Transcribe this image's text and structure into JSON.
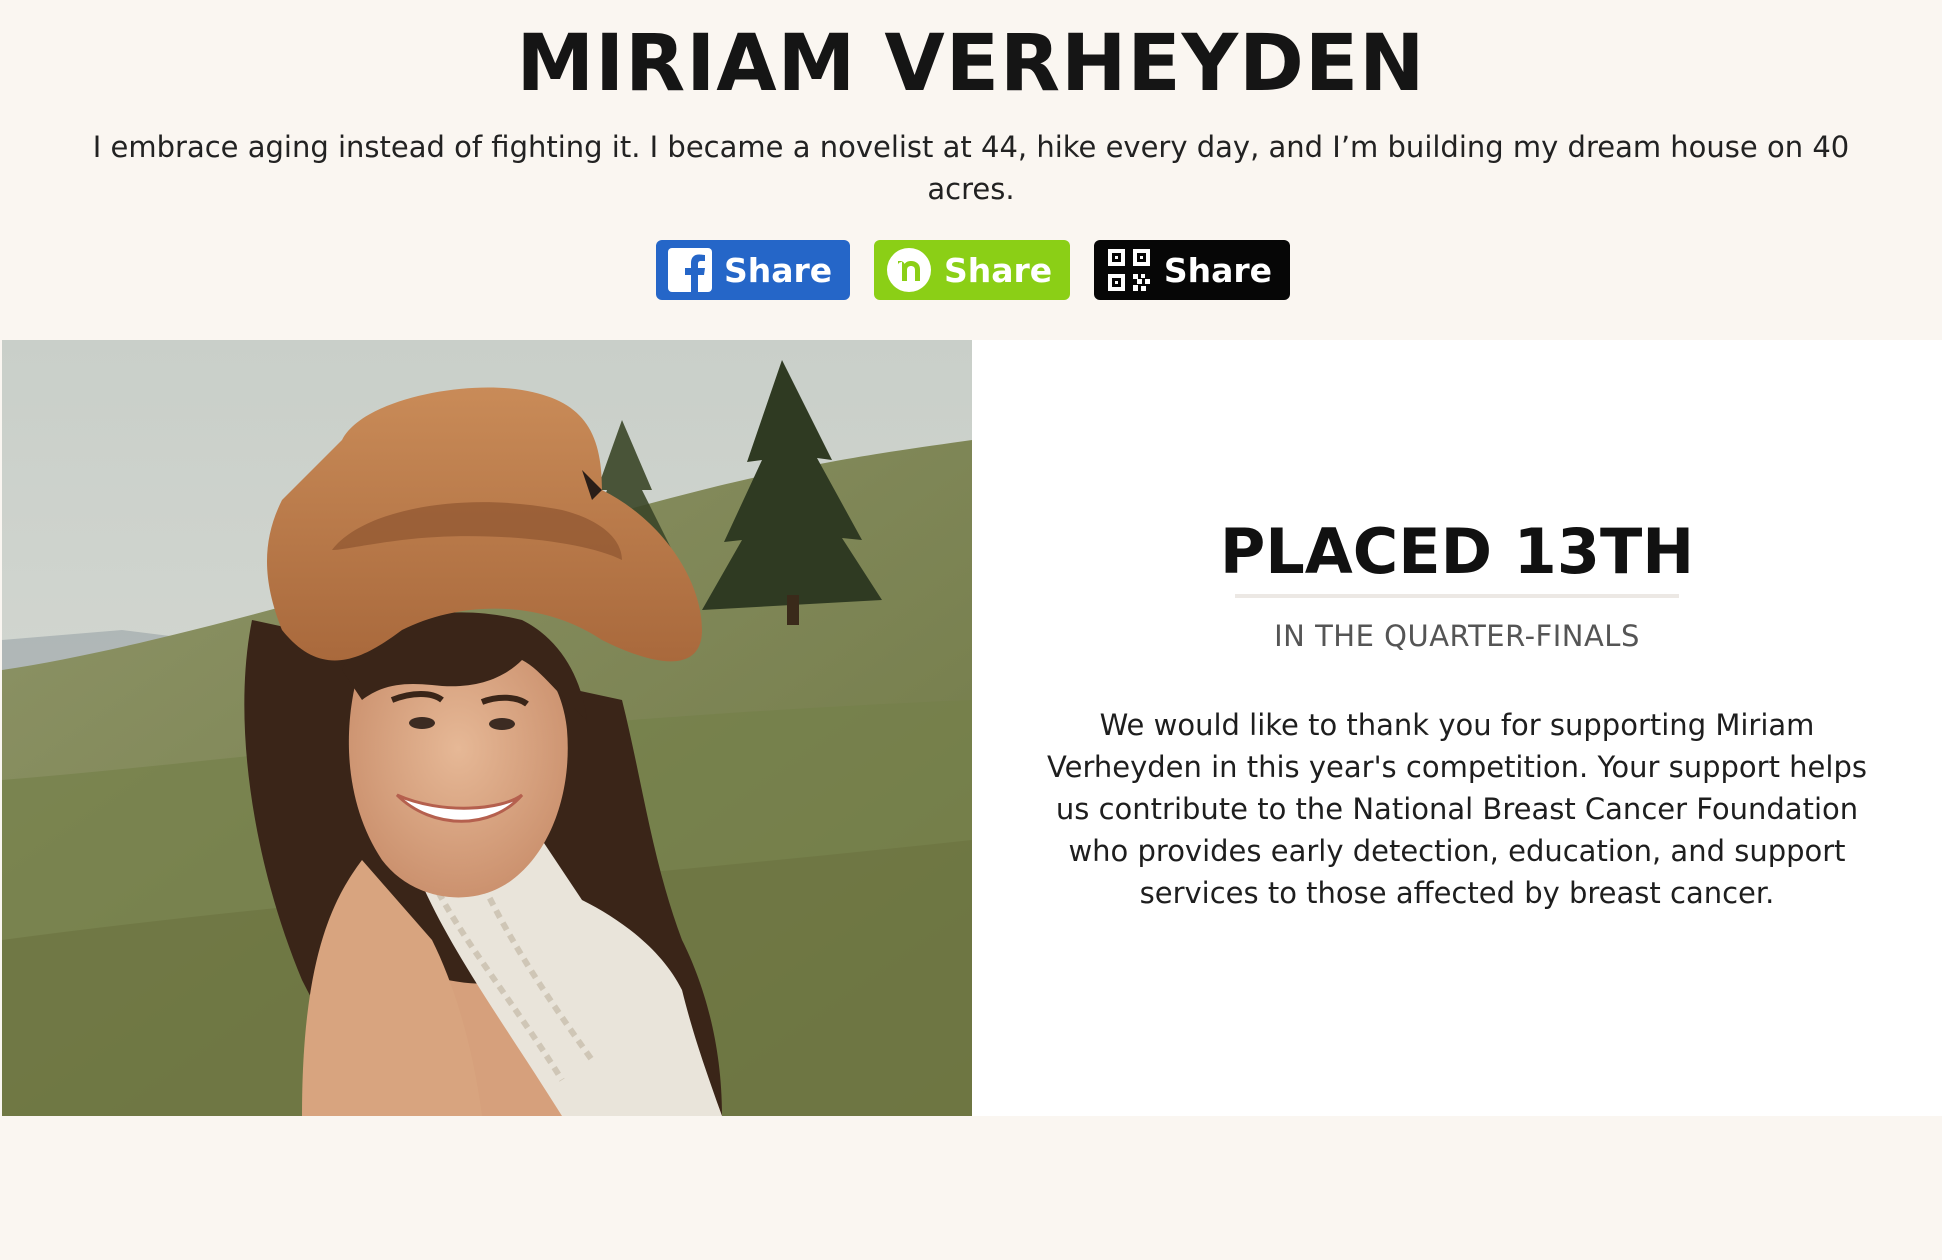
{
  "colors": {
    "page_background": "#faf6f1",
    "facebook_blue": "#2566c8",
    "nextdoor_green": "#8bcf16",
    "qr_black": "#060606",
    "panel_background": "#ffffff"
  },
  "header": {
    "name": "MIRIAM VERHEYDEN",
    "bio": "I embrace aging instead of fighting it. I became a novelist at 44, hike every day, and I’m building my dream house on 40 acres."
  },
  "share_buttons": [
    {
      "icon": "facebook-icon",
      "label": "Share"
    },
    {
      "icon": "nextdoor-icon",
      "label": "Share"
    },
    {
      "icon": "qr-code-icon",
      "label": "Share"
    }
  ],
  "result": {
    "placement": "PLACED 13TH",
    "round": "IN THE QUARTER-FINALS",
    "thanks_message": "We would like to thank you for supporting Miriam Verheyden in this year's competition. Your support helps us contribute to the National Breast Cancer Foundation who provides early detection, education, and support services to those affected by breast cancer."
  }
}
